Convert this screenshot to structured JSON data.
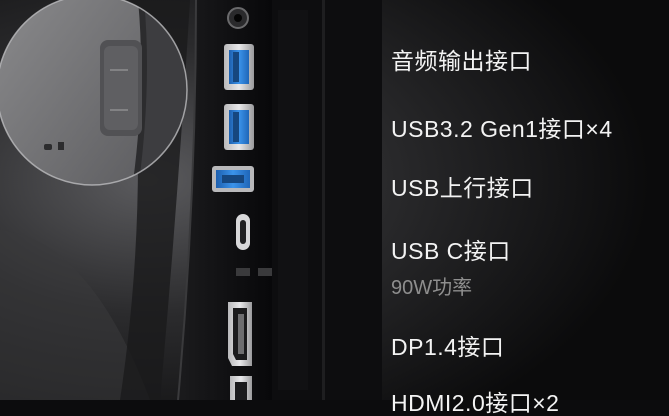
{
  "ports": [
    {
      "label": "音频输出接口"
    },
    {
      "label": "USB3.2 Gen1接口×4"
    },
    {
      "label": "USB上行接口"
    },
    {
      "label": "USB C接口",
      "note": "90W功率"
    },
    {
      "label": "DP1.4接口"
    },
    {
      "label": "HDMI2.0接口×2"
    }
  ],
  "colors": {
    "background": "#0c0c0d",
    "usb_a_blue": "#2e7fd8",
    "usb_b_blue": "#2f86e0",
    "label_text": "#f3f3f3",
    "note_text": "#8e8e8e"
  }
}
